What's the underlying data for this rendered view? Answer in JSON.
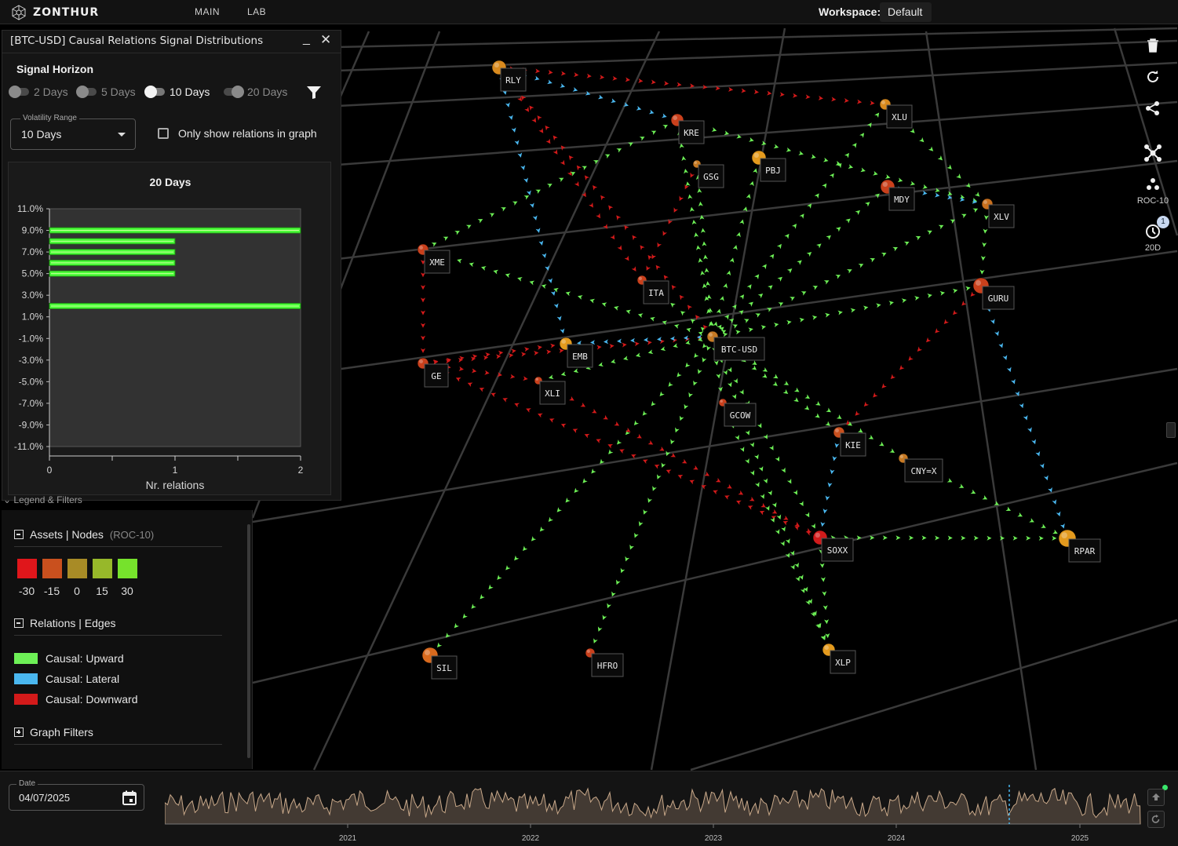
{
  "topbar": {
    "brand": "ZONTHUR",
    "nav": [
      "MAIN",
      "LAB"
    ],
    "workspace_label": "Workspace:",
    "workspace_value": "Default"
  },
  "dist_panel": {
    "title": "[BTC-USD] Causal Relations Signal Distributions",
    "minimize": "_",
    "close": "✕",
    "horizon_title": "Signal Horizon",
    "horizons": [
      {
        "label": "2 Days",
        "on": false
      },
      {
        "label": "5 Days",
        "on": false
      },
      {
        "label": "10 Days",
        "on": true
      },
      {
        "label": "20 Days",
        "on": false
      }
    ],
    "volatility_label": "Volatility Range",
    "volatility_value": "10 Days",
    "only_relations_label": "Only show relations in graph"
  },
  "chart_data": {
    "type": "bar",
    "orientation": "horizontal",
    "title": "20 Days",
    "xlabel": "Nr. relations",
    "ylabel": "",
    "xlim": [
      0,
      2
    ],
    "x_ticks": [
      "0",
      "1",
      "2"
    ],
    "y_ticks": [
      "11.0%",
      "9.0%",
      "7.0%",
      "5.0%",
      "3.0%",
      "1.0%",
      "-1.0%",
      "-3.0%",
      "-5.0%",
      "-7.0%",
      "-9.0%",
      "-11.0%"
    ],
    "ylim": [
      -11,
      11
    ],
    "bars": [
      {
        "y": 9.0,
        "value": 2
      },
      {
        "y": 8.0,
        "value": 1
      },
      {
        "y": 7.0,
        "value": 1
      },
      {
        "y": 6.0,
        "value": 1
      },
      {
        "y": 5.0,
        "value": 1
      },
      {
        "y": 2.0,
        "value": 2
      }
    ],
    "color": "#4cff3a"
  },
  "legend": {
    "tab": "Legend & Filters",
    "assets_title": "Assets | Nodes",
    "assets_sub": "(ROC-10)",
    "scale": [
      {
        "label": "-30",
        "color": "#e0161b"
      },
      {
        "label": "-15",
        "color": "#c9501e"
      },
      {
        "label": "0",
        "color": "#a88b26"
      },
      {
        "label": "15",
        "color": "#97b82a"
      },
      {
        "label": "30",
        "color": "#76e22c"
      }
    ],
    "relations_title": "Relations | Edges",
    "edges": [
      {
        "label": "Causal: Upward",
        "color": "#6df056"
      },
      {
        "label": "Causal: Lateral",
        "color": "#4ab7ef"
      },
      {
        "label": "Causal: Downward",
        "color": "#d31a1a"
      }
    ],
    "filters_title": "Graph Filters"
  },
  "toolbar": {
    "roc_label": "ROC-10",
    "horizon_label": "20D",
    "badge": "1"
  },
  "graph": {
    "center": "BTC-USD",
    "nodes": [
      {
        "id": "RLY",
        "color": "#d88a1e",
        "size": 9
      },
      {
        "id": "XLU",
        "color": "#d88a1e",
        "size": 7
      },
      {
        "id": "KRE",
        "color": "#c9401c",
        "size": 8
      },
      {
        "id": "GSG",
        "color": "#c77a24",
        "size": 5
      },
      {
        "id": "PBJ",
        "color": "#e39a1e",
        "size": 9
      },
      {
        "id": "MDY",
        "color": "#c9401c",
        "size": 9
      },
      {
        "id": "XLV",
        "color": "#c9701e",
        "size": 7
      },
      {
        "id": "XME",
        "color": "#c9401c",
        "size": 7
      },
      {
        "id": "GURU",
        "color": "#c9401c",
        "size": 10
      },
      {
        "id": "ITA",
        "color": "#c9401c",
        "size": 6
      },
      {
        "id": "EMB",
        "color": "#e39a1e",
        "size": 8
      },
      {
        "id": "BTC-USD",
        "color": "#c77a24",
        "size": 7
      },
      {
        "id": "GE",
        "color": "#c9401c",
        "size": 7
      },
      {
        "id": "XLI",
        "color": "#c9401c",
        "size": 5
      },
      {
        "id": "GCOW",
        "color": "#c9401c",
        "size": 5
      },
      {
        "id": "KIE",
        "color": "#c9501e",
        "size": 7
      },
      {
        "id": "CNY=X",
        "color": "#c77a24",
        "size": 6
      },
      {
        "id": "SOXX",
        "color": "#d01b1b",
        "size": 9
      },
      {
        "id": "RPAR",
        "color": "#e39a1e",
        "size": 11
      },
      {
        "id": "SIL",
        "color": "#d86a1e",
        "size": 10
      },
      {
        "id": "HFRO",
        "color": "#c9401c",
        "size": 6
      },
      {
        "id": "XLP",
        "color": "#e39a1e",
        "size": 8
      }
    ],
    "edges": [
      {
        "from": "RLY",
        "to": "XLU",
        "kind": "down"
      },
      {
        "from": "RLY",
        "to": "KRE",
        "kind": "lateral"
      },
      {
        "from": "RLY",
        "to": "EMB",
        "kind": "lateral"
      },
      {
        "from": "RLY",
        "to": "ITA",
        "kind": "down"
      },
      {
        "from": "XLU",
        "to": "XLV",
        "kind": "up"
      },
      {
        "from": "KRE",
        "to": "XLV",
        "kind": "up"
      },
      {
        "from": "MDY",
        "to": "XLV",
        "kind": "lateral"
      },
      {
        "from": "XLV",
        "to": "GURU",
        "kind": "up"
      },
      {
        "from": "GURU",
        "to": "RPAR",
        "kind": "lateral"
      },
      {
        "from": "GURU",
        "to": "KIE",
        "kind": "down"
      },
      {
        "from": "XME",
        "to": "GE",
        "kind": "down"
      },
      {
        "from": "XME",
        "to": "KRE",
        "kind": "up"
      },
      {
        "from": "GE",
        "to": "BTC-USD",
        "kind": "down"
      },
      {
        "from": "GE",
        "to": "XLI",
        "kind": "down"
      },
      {
        "from": "SOXX",
        "to": "RPAR",
        "kind": "up"
      },
      {
        "from": "SOXX",
        "to": "GE",
        "kind": "down"
      },
      {
        "from": "KIE",
        "to": "SOXX",
        "kind": "lateral"
      },
      {
        "from": "CNY=X",
        "to": "RPAR",
        "kind": "up"
      },
      {
        "from": "GCOW",
        "to": "XLP",
        "kind": "up"
      },
      {
        "from": "SOXX",
        "to": "XLP",
        "kind": "up"
      },
      {
        "from": "BTC-USD",
        "to": "XLU",
        "kind": "up"
      },
      {
        "from": "BTC-USD",
        "to": "KRE",
        "kind": "up"
      },
      {
        "from": "BTC-USD",
        "to": "GSG",
        "kind": "up"
      },
      {
        "from": "BTC-USD",
        "to": "PBJ",
        "kind": "up"
      },
      {
        "from": "BTC-USD",
        "to": "MDY",
        "kind": "up"
      },
      {
        "from": "BTC-USD",
        "to": "XLV",
        "kind": "up"
      },
      {
        "from": "BTC-USD",
        "to": "XME",
        "kind": "up"
      },
      {
        "from": "BTC-USD",
        "to": "GURU",
        "kind": "up"
      },
      {
        "from": "BTC-USD",
        "to": "ITA",
        "kind": "up"
      },
      {
        "from": "BTC-USD",
        "to": "EMB",
        "kind": "lateral"
      },
      {
        "from": "BTC-USD",
        "to": "XLI",
        "kind": "up"
      },
      {
        "from": "BTC-USD",
        "to": "GCOW",
        "kind": "up"
      },
      {
        "from": "BTC-USD",
        "to": "KIE",
        "kind": "up"
      },
      {
        "from": "BTC-USD",
        "to": "CNY=X",
        "kind": "up"
      },
      {
        "from": "BTC-USD",
        "to": "SOXX",
        "kind": "up"
      },
      {
        "from": "BTC-USD",
        "to": "SIL",
        "kind": "up"
      },
      {
        "from": "BTC-USD",
        "to": "HFRO",
        "kind": "up"
      },
      {
        "from": "BTC-USD",
        "to": "XLP",
        "kind": "up"
      },
      {
        "from": "BTC-USD",
        "to": "RLY",
        "kind": "down"
      },
      {
        "from": "GSG",
        "to": "ITA",
        "kind": "down"
      },
      {
        "from": "GE",
        "to": "EMB",
        "kind": "down"
      },
      {
        "from": "XLI",
        "to": "SOXX",
        "kind": "down"
      }
    ]
  },
  "timeline": {
    "date_label": "Date",
    "date_value": "04/07/2025",
    "years": [
      "2021",
      "2022",
      "2023",
      "2024",
      "2025"
    ]
  }
}
